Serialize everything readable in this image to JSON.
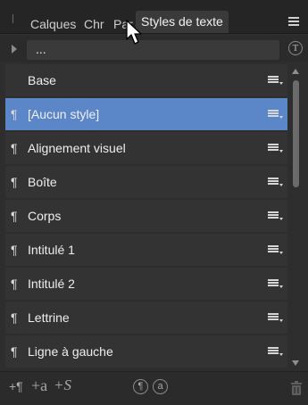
{
  "tabs": {
    "calques": "Calques",
    "chr": "Chr",
    "par": "Par",
    "styles_texte": "Styles de texte"
  },
  "path": {
    "value": "..."
  },
  "styles": [
    {
      "label": "Base",
      "pilcrow": "",
      "selected": false
    },
    {
      "label": "[Aucun style]",
      "pilcrow": "¶",
      "selected": true
    },
    {
      "label": "Alignement visuel",
      "pilcrow": "¶",
      "selected": false
    },
    {
      "label": "Boîte",
      "pilcrow": "¶",
      "selected": false
    },
    {
      "label": "Corps",
      "pilcrow": "¶",
      "selected": false
    },
    {
      "label": "Intitulé 1",
      "pilcrow": "¶",
      "selected": false
    },
    {
      "label": "Intitulé 2",
      "pilcrow": "¶",
      "selected": false
    },
    {
      "label": "Lettrine",
      "pilcrow": "¶",
      "selected": false
    },
    {
      "label": "Ligne à gauche",
      "pilcrow": "¶",
      "selected": false
    }
  ],
  "toolbar": {
    "add_paragraph": "+¶",
    "add_character": "+a",
    "add_group": "+S",
    "paragraph_circle": "¶",
    "character_circle": "a"
  },
  "colors": {
    "selection": "#5b86c8",
    "row": "#333333",
    "panel": "#2e2e2e"
  },
  "icons": [
    "panel-menu-icon",
    "cursor-icon",
    "expand-arrow-icon",
    "text-style-icon",
    "row-menu-icon",
    "scroll-up-icon",
    "scroll-down-icon",
    "add-paragraph-style-icon",
    "add-character-style-icon",
    "add-group-icon",
    "paragraph-circle-icon",
    "character-circle-icon",
    "trash-icon"
  ]
}
